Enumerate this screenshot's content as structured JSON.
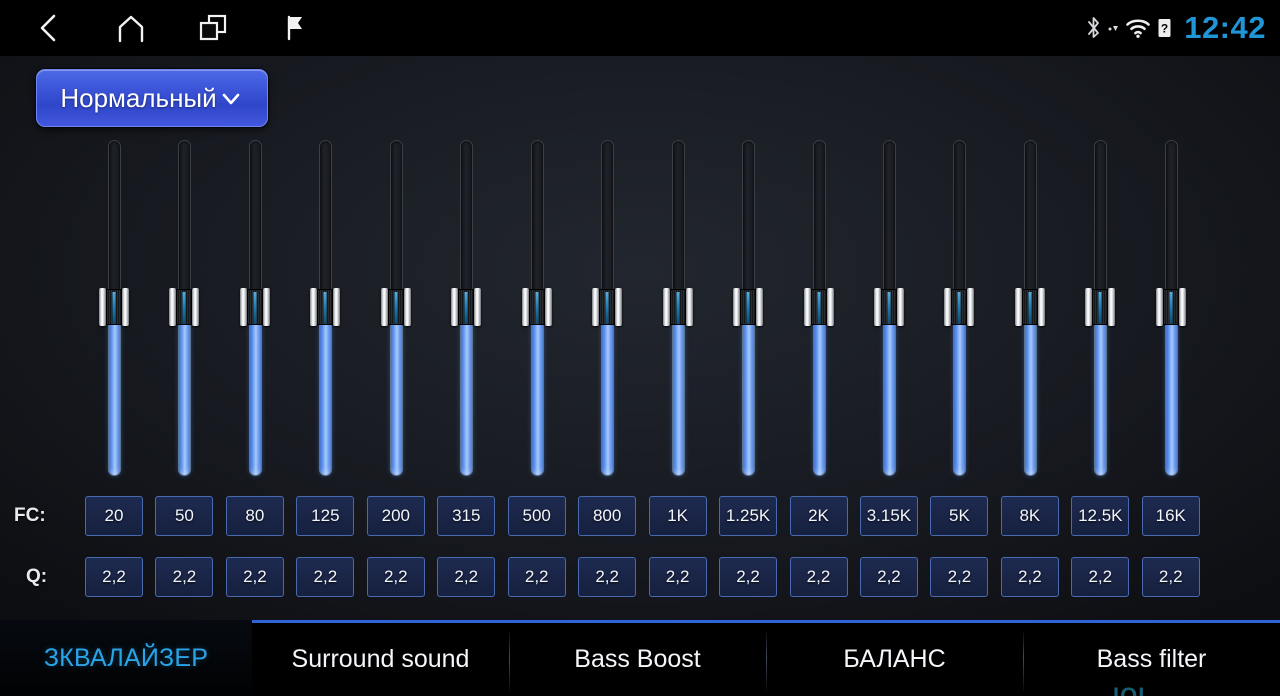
{
  "statusbar": {
    "nav": [
      {
        "name": "back-icon",
        "label": "Back"
      },
      {
        "name": "home-icon",
        "label": "Home"
      },
      {
        "name": "recents-icon",
        "label": "Recent apps"
      },
      {
        "name": "flag-icon",
        "label": "Navigation"
      }
    ],
    "icons": [
      "bluetooth-icon",
      "signal-icon",
      "wifi-icon",
      "sim-unknown-icon"
    ],
    "clock": "12:42"
  },
  "preset": {
    "label": "Нормальный",
    "chevron": "chevron-down-icon"
  },
  "equalizer": {
    "fc_label": "FC:",
    "q_label": "Q:",
    "bands": [
      {
        "fc": "20",
        "q": "2,2",
        "value": 50
      },
      {
        "fc": "50",
        "q": "2,2",
        "value": 50
      },
      {
        "fc": "80",
        "q": "2,2",
        "value": 50
      },
      {
        "fc": "125",
        "q": "2,2",
        "value": 50
      },
      {
        "fc": "200",
        "q": "2,2",
        "value": 50
      },
      {
        "fc": "315",
        "q": "2,2",
        "value": 50
      },
      {
        "fc": "500",
        "q": "2,2",
        "value": 50
      },
      {
        "fc": "800",
        "q": "2,2",
        "value": 50
      },
      {
        "fc": "1K",
        "q": "2,2",
        "value": 50
      },
      {
        "fc": "1.25K",
        "q": "2,2",
        "value": 50
      },
      {
        "fc": "2K",
        "q": "2,2",
        "value": 50
      },
      {
        "fc": "3.15K",
        "q": "2,2",
        "value": 50
      },
      {
        "fc": "5K",
        "q": "2,2",
        "value": 50
      },
      {
        "fc": "8K",
        "q": "2,2",
        "value": 50
      },
      {
        "fc": "12.5K",
        "q": "2,2",
        "value": 50
      },
      {
        "fc": "16K",
        "q": "2,2",
        "value": 50
      }
    ]
  },
  "tabs": {
    "active": "ЗКВАЛАЙЗЕР",
    "items": [
      "Surround sound",
      "Bass Boost",
      "БАЛАНС",
      "Bass filter"
    ]
  },
  "watermark": "IQI",
  "colors": {
    "accent_blue": "#2aa4e8",
    "clock_blue": "#2196d6",
    "preset_blue": "#3f59dc",
    "slider_fill": "#8ab6f7",
    "cell_border": "#4a6ab0",
    "cell_bg": "#1a2547",
    "tab_top_border": "#2f63d8"
  }
}
